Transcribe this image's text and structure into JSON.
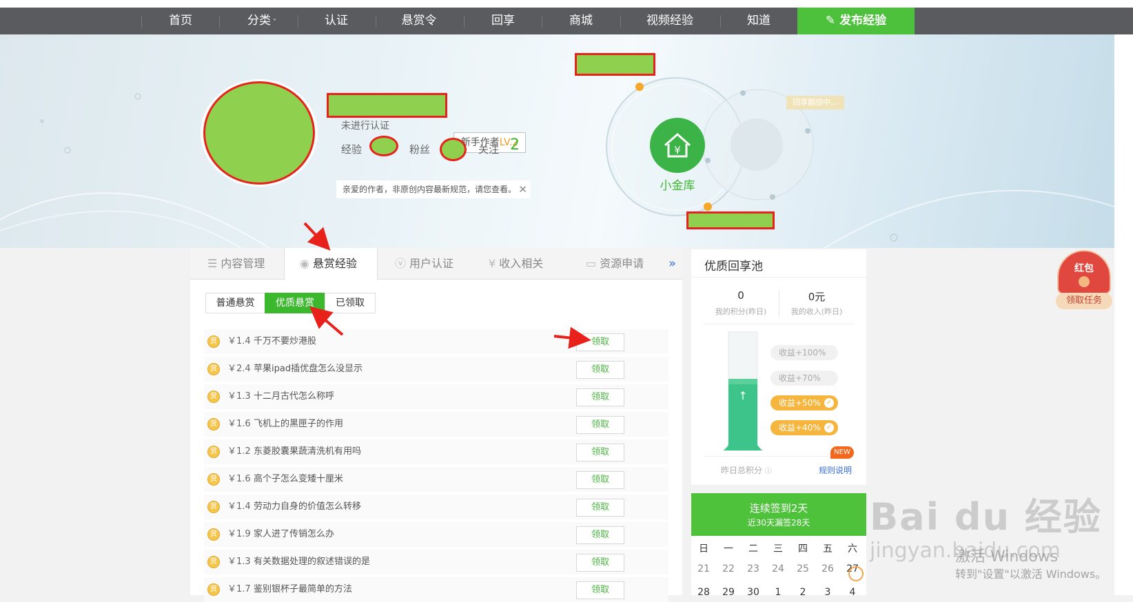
{
  "nav": {
    "items": [
      "首页",
      "分类",
      "认证",
      "悬赏令",
      "回享",
      "商城",
      "视频经验",
      "知道"
    ],
    "publish_label": "发布经验"
  },
  "profile": {
    "level_prefix": "新手作者",
    "level": "LV.2",
    "cert_status": "未进行认证",
    "exp_label": "经验",
    "fans_label": "粉丝",
    "follow_label": "关注",
    "follow_count": "2",
    "notice": "亲爱的作者，非原创内容最新规范，请您查看。",
    "vault_label": "小金库",
    "share_flip_badge": "回享翻倍中..."
  },
  "tabs": {
    "items": [
      "内容管理",
      "悬赏经验",
      "用户认证",
      "收入相关",
      "资源申请"
    ],
    "active": "悬赏经验",
    "more": "»"
  },
  "subtabs": {
    "items": [
      "普通悬赏",
      "优质悬赏",
      "已领取"
    ],
    "active": "优质悬赏"
  },
  "bounties": [
    {
      "amount": "￥1.4",
      "title": "千万不要炒港股",
      "action": "领取"
    },
    {
      "amount": "￥2.4",
      "title": "苹果ipad插优盘怎么没显示",
      "action": "领取"
    },
    {
      "amount": "￥1.3",
      "title": "十二月古代怎么称呼",
      "action": "领取"
    },
    {
      "amount": "￥1.6",
      "title": "飞机上的黑匣子的作用",
      "action": "领取"
    },
    {
      "amount": "￥1.2",
      "title": "东菱胶囊果蔬清洗机有用吗",
      "action": "领取"
    },
    {
      "amount": "￥1.6",
      "title": "高个子怎么变矮十厘米",
      "action": "领取"
    },
    {
      "amount": "￥1.4",
      "title": "劳动力自身的价值怎么转移",
      "action": "领取"
    },
    {
      "amount": "￥1.9",
      "title": "家人进了传销怎么办",
      "action": "领取"
    },
    {
      "amount": "￥1.3",
      "title": "有关数据处理的叙述错误的是",
      "action": "领取"
    },
    {
      "amount": "￥1.7",
      "title": "鉴别银杯子最简单的方法",
      "action": "领取"
    }
  ],
  "pool": {
    "title": "优质回享池",
    "points_value": "0",
    "points_label": "我的积分(昨日)",
    "income_value": "0元",
    "income_label": "我的收入(昨日)",
    "levels": [
      "收益+100%",
      "收益+70%",
      "收益+50%",
      "收益+40%"
    ],
    "total_label": "昨日总积分",
    "rules_label": "规则说明",
    "new_badge": "NEW"
  },
  "signin": {
    "title": "连续签到2天",
    "subtitle": "近30天漏签28天"
  },
  "calendar": {
    "weekdays": [
      "日",
      "一",
      "二",
      "三",
      "四",
      "五",
      "六"
    ],
    "row1": [
      "21",
      "22",
      "23",
      "24",
      "25",
      "26",
      "27"
    ],
    "row2": [
      "28",
      "29",
      "30",
      "1",
      "2",
      "3",
      "4"
    ]
  },
  "redpacket": {
    "title": "红包",
    "task": "领取任务"
  },
  "watermark": {
    "brand": "Bai du 经验",
    "url": "jingyan.baidu.com",
    "activate_title": "激活 Windows",
    "activate_sub": "转到\"设置\"以激活 Windows。"
  },
  "colors": {
    "accent_green": "#3cb82e",
    "nav_bg": "#5a5b5e",
    "annotation_red": "#e8211a",
    "redaction_green": "#8fd14f"
  }
}
